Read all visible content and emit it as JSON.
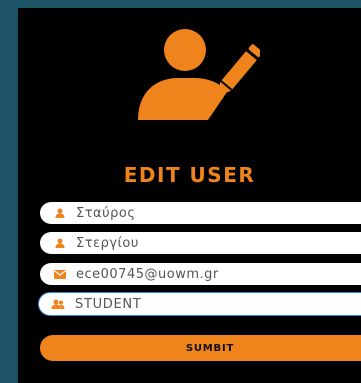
{
  "form": {
    "title": "EDIT USER",
    "accent_color": "#f0841c",
    "hero_icon": "user-edit-icon",
    "fields": [
      {
        "icon": "user-icon",
        "value": "Σταύρος"
      },
      {
        "icon": "user-icon",
        "value": "Στεργίου"
      },
      {
        "icon": "envelope-icon",
        "value": "ece00745@uowm.gr"
      }
    ],
    "role_select": {
      "icon": "users-icon",
      "selected": "STUDENT"
    },
    "submit_label": "SUMBIT"
  }
}
